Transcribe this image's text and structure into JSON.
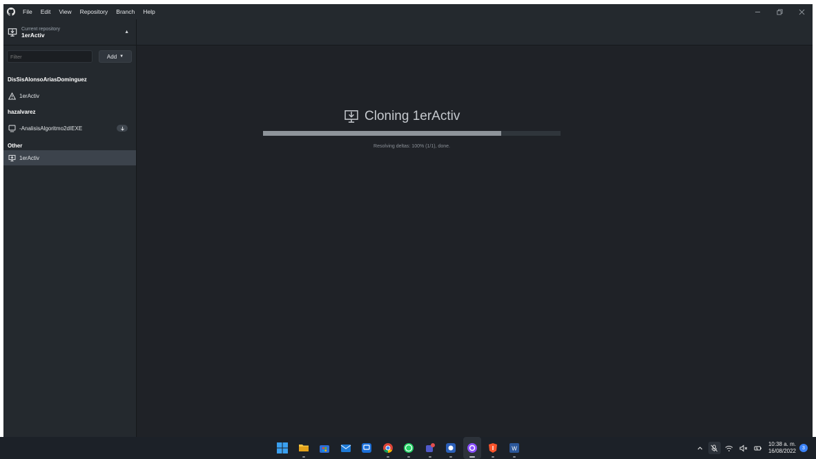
{
  "menu": {
    "items": [
      "File",
      "Edit",
      "View",
      "Repository",
      "Branch",
      "Help"
    ]
  },
  "window_controls": [
    "minimize-icon",
    "restore-icon",
    "close-icon"
  ],
  "toolbar": {
    "current_repo_label": "Current repository",
    "current_repo_name": "1erActiv"
  },
  "sidebar": {
    "filter_placeholder": "Filter",
    "add_label": "Add",
    "groups": [
      {
        "name": "DisSisAlonsoAriasDominguez",
        "repos": [
          {
            "name": "1erActiv",
            "icon": "warning-icon"
          }
        ]
      },
      {
        "name": "hazalvarez",
        "repos": [
          {
            "name": "-AnalisisAlgoritmo2dIEXE",
            "icon": "repo-icon",
            "badge": "download-icon"
          }
        ]
      },
      {
        "name": "Other",
        "repos": [
          {
            "name": "1erActiv",
            "icon": "clone-icon",
            "selected": true
          }
        ]
      }
    ]
  },
  "main": {
    "clone_title": "Cloning 1erActiv",
    "progress": 0.8,
    "progress_text": "Resolving deltas: 100% (1/1), done."
  },
  "taskbar": {
    "apps": [
      "windows-start-icon",
      "file-explorer-icon",
      "store-icon",
      "mail-icon",
      "edge-icon",
      "chrome-icon",
      "whatsapp-icon",
      "teams-icon",
      "app-icon",
      "github-desktop-icon",
      "brave-icon",
      "word-icon"
    ],
    "time": "10:38 a. m.",
    "date": "16/08/2022",
    "notification_count": "3"
  },
  "colors": {
    "background": "#1f2227",
    "panel": "#24292e",
    "selected": "#3c434c",
    "progress_fill": "#8e949a"
  }
}
